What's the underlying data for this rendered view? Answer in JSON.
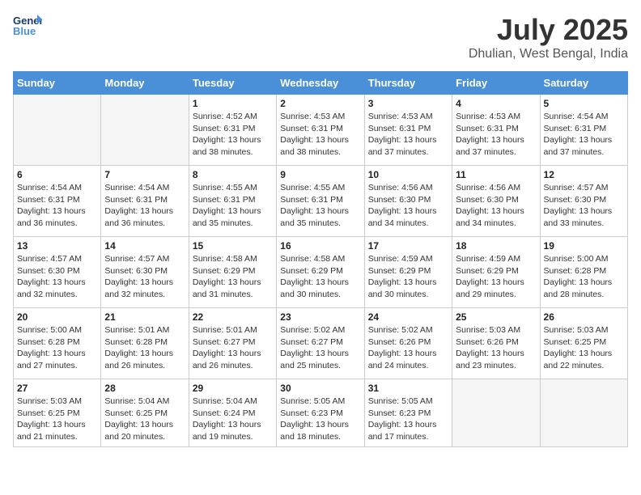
{
  "logo": {
    "line1": "General",
    "line2": "Blue"
  },
  "header": {
    "month_year": "July 2025",
    "location": "Dhulian, West Bengal, India"
  },
  "weekdays": [
    "Sunday",
    "Monday",
    "Tuesday",
    "Wednesday",
    "Thursday",
    "Friday",
    "Saturday"
  ],
  "weeks": [
    [
      {
        "day": "",
        "sunrise": "",
        "sunset": "",
        "daylight": ""
      },
      {
        "day": "",
        "sunrise": "",
        "sunset": "",
        "daylight": ""
      },
      {
        "day": "1",
        "sunrise": "Sunrise: 4:52 AM",
        "sunset": "Sunset: 6:31 PM",
        "daylight": "Daylight: 13 hours and 38 minutes."
      },
      {
        "day": "2",
        "sunrise": "Sunrise: 4:53 AM",
        "sunset": "Sunset: 6:31 PM",
        "daylight": "Daylight: 13 hours and 38 minutes."
      },
      {
        "day": "3",
        "sunrise": "Sunrise: 4:53 AM",
        "sunset": "Sunset: 6:31 PM",
        "daylight": "Daylight: 13 hours and 37 minutes."
      },
      {
        "day": "4",
        "sunrise": "Sunrise: 4:53 AM",
        "sunset": "Sunset: 6:31 PM",
        "daylight": "Daylight: 13 hours and 37 minutes."
      },
      {
        "day": "5",
        "sunrise": "Sunrise: 4:54 AM",
        "sunset": "Sunset: 6:31 PM",
        "daylight": "Daylight: 13 hours and 37 minutes."
      }
    ],
    [
      {
        "day": "6",
        "sunrise": "Sunrise: 4:54 AM",
        "sunset": "Sunset: 6:31 PM",
        "daylight": "Daylight: 13 hours and 36 minutes."
      },
      {
        "day": "7",
        "sunrise": "Sunrise: 4:54 AM",
        "sunset": "Sunset: 6:31 PM",
        "daylight": "Daylight: 13 hours and 36 minutes."
      },
      {
        "day": "8",
        "sunrise": "Sunrise: 4:55 AM",
        "sunset": "Sunset: 6:31 PM",
        "daylight": "Daylight: 13 hours and 35 minutes."
      },
      {
        "day": "9",
        "sunrise": "Sunrise: 4:55 AM",
        "sunset": "Sunset: 6:31 PM",
        "daylight": "Daylight: 13 hours and 35 minutes."
      },
      {
        "day": "10",
        "sunrise": "Sunrise: 4:56 AM",
        "sunset": "Sunset: 6:30 PM",
        "daylight": "Daylight: 13 hours and 34 minutes."
      },
      {
        "day": "11",
        "sunrise": "Sunrise: 4:56 AM",
        "sunset": "Sunset: 6:30 PM",
        "daylight": "Daylight: 13 hours and 34 minutes."
      },
      {
        "day": "12",
        "sunrise": "Sunrise: 4:57 AM",
        "sunset": "Sunset: 6:30 PM",
        "daylight": "Daylight: 13 hours and 33 minutes."
      }
    ],
    [
      {
        "day": "13",
        "sunrise": "Sunrise: 4:57 AM",
        "sunset": "Sunset: 6:30 PM",
        "daylight": "Daylight: 13 hours and 32 minutes."
      },
      {
        "day": "14",
        "sunrise": "Sunrise: 4:57 AM",
        "sunset": "Sunset: 6:30 PM",
        "daylight": "Daylight: 13 hours and 32 minutes."
      },
      {
        "day": "15",
        "sunrise": "Sunrise: 4:58 AM",
        "sunset": "Sunset: 6:29 PM",
        "daylight": "Daylight: 13 hours and 31 minutes."
      },
      {
        "day": "16",
        "sunrise": "Sunrise: 4:58 AM",
        "sunset": "Sunset: 6:29 PM",
        "daylight": "Daylight: 13 hours and 30 minutes."
      },
      {
        "day": "17",
        "sunrise": "Sunrise: 4:59 AM",
        "sunset": "Sunset: 6:29 PM",
        "daylight": "Daylight: 13 hours and 30 minutes."
      },
      {
        "day": "18",
        "sunrise": "Sunrise: 4:59 AM",
        "sunset": "Sunset: 6:29 PM",
        "daylight": "Daylight: 13 hours and 29 minutes."
      },
      {
        "day": "19",
        "sunrise": "Sunrise: 5:00 AM",
        "sunset": "Sunset: 6:28 PM",
        "daylight": "Daylight: 13 hours and 28 minutes."
      }
    ],
    [
      {
        "day": "20",
        "sunrise": "Sunrise: 5:00 AM",
        "sunset": "Sunset: 6:28 PM",
        "daylight": "Daylight: 13 hours and 27 minutes."
      },
      {
        "day": "21",
        "sunrise": "Sunrise: 5:01 AM",
        "sunset": "Sunset: 6:28 PM",
        "daylight": "Daylight: 13 hours and 26 minutes."
      },
      {
        "day": "22",
        "sunrise": "Sunrise: 5:01 AM",
        "sunset": "Sunset: 6:27 PM",
        "daylight": "Daylight: 13 hours and 26 minutes."
      },
      {
        "day": "23",
        "sunrise": "Sunrise: 5:02 AM",
        "sunset": "Sunset: 6:27 PM",
        "daylight": "Daylight: 13 hours and 25 minutes."
      },
      {
        "day": "24",
        "sunrise": "Sunrise: 5:02 AM",
        "sunset": "Sunset: 6:26 PM",
        "daylight": "Daylight: 13 hours and 24 minutes."
      },
      {
        "day": "25",
        "sunrise": "Sunrise: 5:03 AM",
        "sunset": "Sunset: 6:26 PM",
        "daylight": "Daylight: 13 hours and 23 minutes."
      },
      {
        "day": "26",
        "sunrise": "Sunrise: 5:03 AM",
        "sunset": "Sunset: 6:25 PM",
        "daylight": "Daylight: 13 hours and 22 minutes."
      }
    ],
    [
      {
        "day": "27",
        "sunrise": "Sunrise: 5:03 AM",
        "sunset": "Sunset: 6:25 PM",
        "daylight": "Daylight: 13 hours and 21 minutes."
      },
      {
        "day": "28",
        "sunrise": "Sunrise: 5:04 AM",
        "sunset": "Sunset: 6:25 PM",
        "daylight": "Daylight: 13 hours and 20 minutes."
      },
      {
        "day": "29",
        "sunrise": "Sunrise: 5:04 AM",
        "sunset": "Sunset: 6:24 PM",
        "daylight": "Daylight: 13 hours and 19 minutes."
      },
      {
        "day": "30",
        "sunrise": "Sunrise: 5:05 AM",
        "sunset": "Sunset: 6:23 PM",
        "daylight": "Daylight: 13 hours and 18 minutes."
      },
      {
        "day": "31",
        "sunrise": "Sunrise: 5:05 AM",
        "sunset": "Sunset: 6:23 PM",
        "daylight": "Daylight: 13 hours and 17 minutes."
      },
      {
        "day": "",
        "sunrise": "",
        "sunset": "",
        "daylight": ""
      },
      {
        "day": "",
        "sunrise": "",
        "sunset": "",
        "daylight": ""
      }
    ]
  ]
}
